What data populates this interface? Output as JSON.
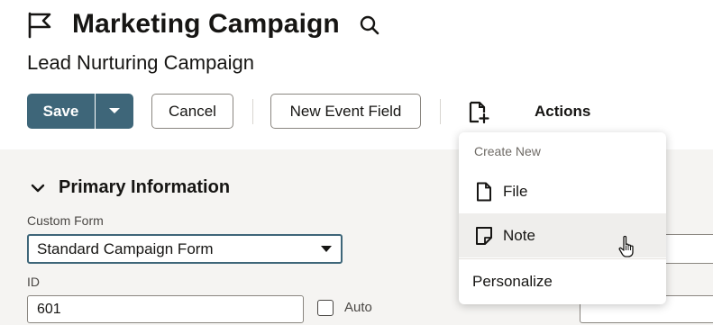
{
  "record": {
    "type_title": "Marketing Campaign",
    "name": "Lead Nurturing Campaign"
  },
  "toolbar": {
    "save_label": "Save",
    "cancel_label": "Cancel",
    "new_event_field_label": "New Event Field",
    "actions_label": "Actions",
    "icons": [
      "flag-icon",
      "search-icon",
      "chevron-down-icon",
      "new-document-icon"
    ]
  },
  "primary_section": {
    "title": "Primary Information",
    "custom_form": {
      "label": "Custom Form",
      "value": "Standard Campaign Form"
    },
    "id_field": {
      "label": "ID",
      "value": "601",
      "auto_label": "Auto",
      "auto_checked": false
    }
  },
  "create_menu": {
    "heading": "Create New",
    "items": [
      {
        "label": "File",
        "icon": "file-icon"
      },
      {
        "label": "Note",
        "icon": "note-icon",
        "hovered": true
      },
      {
        "label": "Personalize"
      }
    ]
  },
  "colors": {
    "primary_button": "#3e6679",
    "page_background": "#f5f4f2",
    "menu_hover": "#efeeec"
  }
}
